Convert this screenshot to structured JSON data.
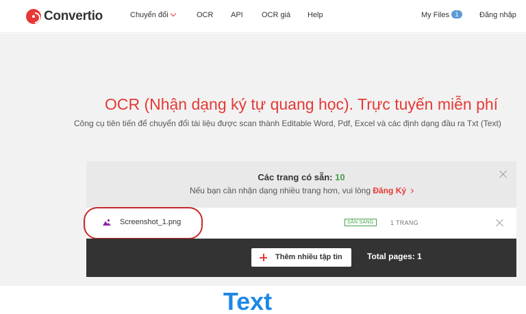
{
  "header": {
    "logo_text": "Convertio",
    "nav": {
      "convert": "Chuyển đổi",
      "ocr": "OCR",
      "api": "API",
      "ocr_pricing": "OCR giá",
      "help": "Help"
    },
    "my_files": "My Files",
    "my_files_count": "1",
    "login": "Đăng nhập"
  },
  "hero": {
    "title": "OCR (Nhận dạng ký tự quang học). Trực tuyến miễn phí",
    "subtitle": "Công cụ tiên tiến để chuyển đổi tài liệu được scan thành Editable Word, Pdf, Excel và các định dạng đầu ra Txt (Text)"
  },
  "panel": {
    "pages_available_label": "Các trang có sẵn:",
    "pages_available_count": "10",
    "signup_prompt": "Nếu bạn cần nhận dạng nhiều trang hơn, vui lòng",
    "signup_link": "Đăng Ký"
  },
  "file": {
    "name": "Screenshot_1.png",
    "status": "SẴN SÀNG",
    "pages": "1 TRANG"
  },
  "footer_bar": {
    "add_more": "Thêm nhiều tập tin",
    "total_pages": "Total pages: 1"
  },
  "caption": "Text",
  "colors": {
    "brand_red": "#e53935",
    "ready_green": "#43a047",
    "caption_blue": "#1e88e5"
  }
}
